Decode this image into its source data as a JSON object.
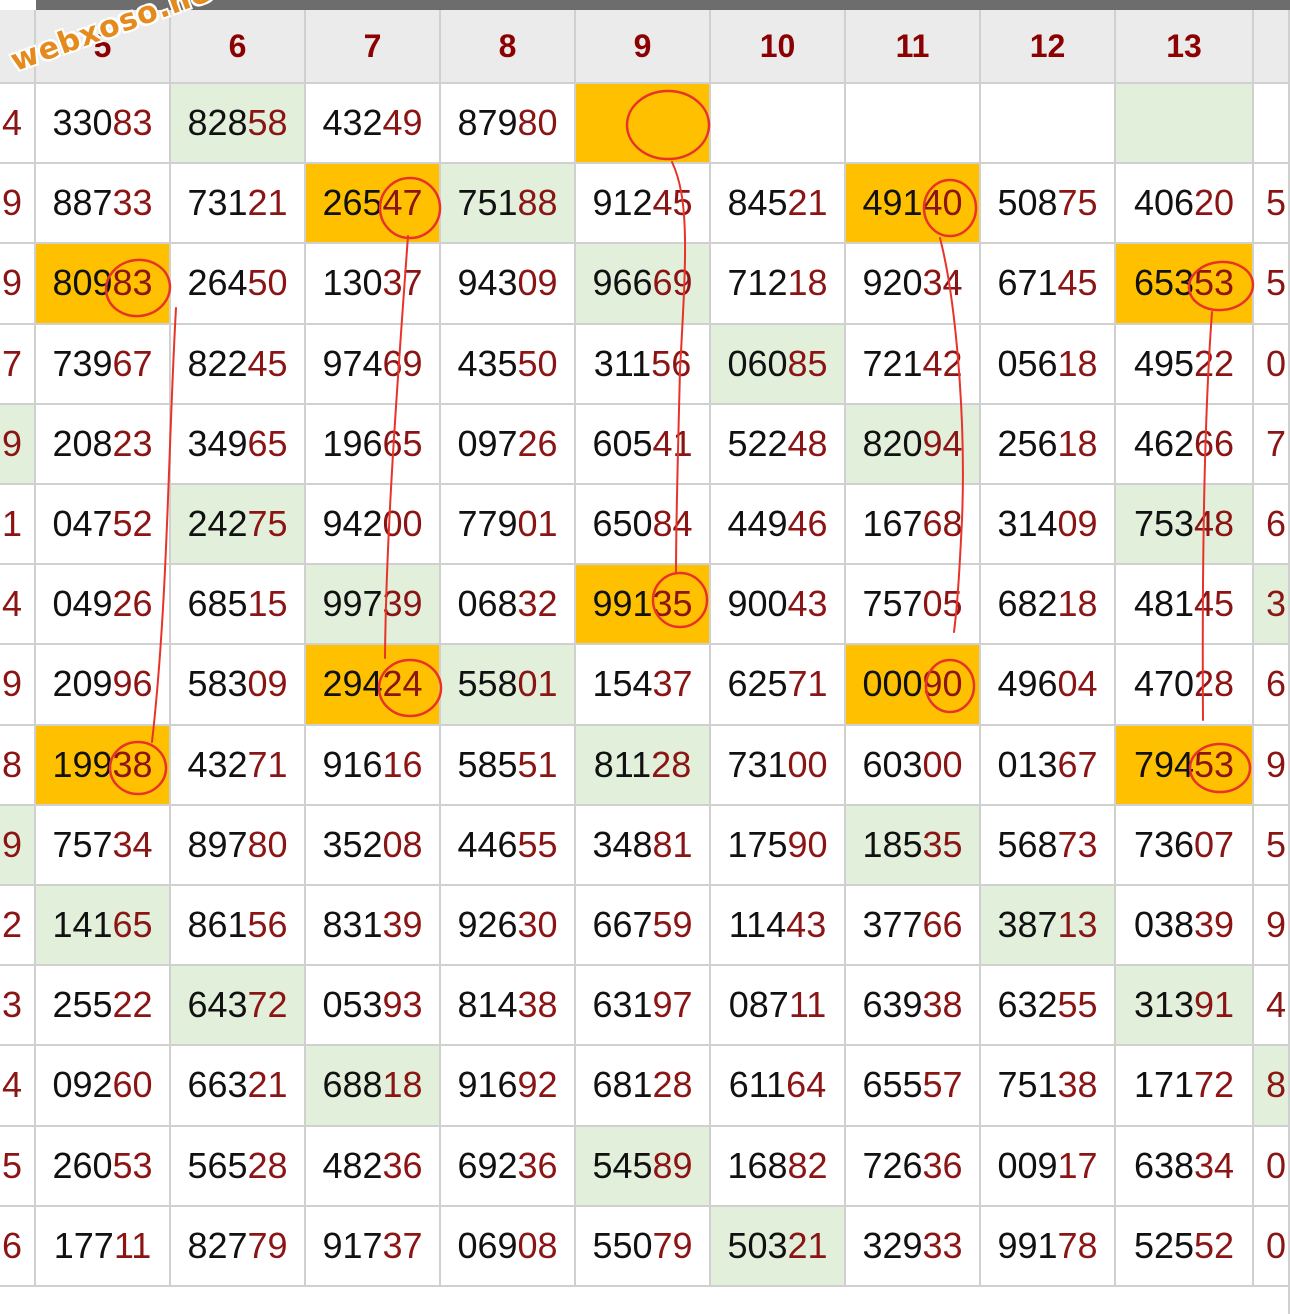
{
  "watermark": "webxoso.net",
  "headers": [
    "5",
    "6",
    "7",
    "8",
    "9",
    "10",
    "11",
    "12",
    "13"
  ],
  "rows": [
    {
      "left": "4",
      "cells": [
        "33083",
        "82858",
        "43249",
        "87980",
        "",
        "",
        "",
        "",
        ""
      ],
      "right": ""
    },
    {
      "left": "9",
      "cells": [
        "88733",
        "73121",
        "26547",
        "75188",
        "91245",
        "84521",
        "49140",
        "50875",
        "40620"
      ],
      "right": "5"
    },
    {
      "left": "9",
      "cells": [
        "80983",
        "26450",
        "13037",
        "94309",
        "96669",
        "71218",
        "92034",
        "67145",
        "65353"
      ],
      "right": "5"
    },
    {
      "left": "7",
      "cells": [
        "73967",
        "82245",
        "97469",
        "43550",
        "31156",
        "06085",
        "72142",
        "05618",
        "49522"
      ],
      "right": "0"
    },
    {
      "left": "9",
      "cells": [
        "20823",
        "34965",
        "19665",
        "09726",
        "60541",
        "52248",
        "82094",
        "25618",
        "46266"
      ],
      "right": "7"
    },
    {
      "left": "1",
      "cells": [
        "04752",
        "24275",
        "94200",
        "77901",
        "65084",
        "44946",
        "16768",
        "31409",
        "75348"
      ],
      "right": "6"
    },
    {
      "left": "4",
      "cells": [
        "04926",
        "68515",
        "99739",
        "06832",
        "99135",
        "90043",
        "75705",
        "68218",
        "48145"
      ],
      "right": "3"
    },
    {
      "left": "9",
      "cells": [
        "20996",
        "58309",
        "29424",
        "55801",
        "15437",
        "62571",
        "00090",
        "49604",
        "47028"
      ],
      "right": "6"
    },
    {
      "left": "8",
      "cells": [
        "19938",
        "43271",
        "91616",
        "58551",
        "81128",
        "73100",
        "60300",
        "01367",
        "79453"
      ],
      "right": "9"
    },
    {
      "left": "9",
      "cells": [
        "75734",
        "89780",
        "35208",
        "44655",
        "34881",
        "17590",
        "18535",
        "56873",
        "73607"
      ],
      "right": "5"
    },
    {
      "left": "2",
      "cells": [
        "14165",
        "86156",
        "83139",
        "92630",
        "66759",
        "11443",
        "37766",
        "38713",
        "03839"
      ],
      "right": "9"
    },
    {
      "left": "3",
      "cells": [
        "25522",
        "64372",
        "05393",
        "81438",
        "63197",
        "08711",
        "63938",
        "63255",
        "31391"
      ],
      "right": "4"
    },
    {
      "left": "4",
      "cells": [
        "09260",
        "66321",
        "68818",
        "91692",
        "68128",
        "61164",
        "65557",
        "75138",
        "17172"
      ],
      "right": "8"
    },
    {
      "left": "5",
      "cells": [
        "26053",
        "56528",
        "48236",
        "69236",
        "54589",
        "16882",
        "72636",
        "00917",
        "63834"
      ],
      "right": "0"
    },
    {
      "left": "6",
      "cells": [
        "17711",
        "82779",
        "91737",
        "06908",
        "55079",
        "50321",
        "32933",
        "99178",
        "52552"
      ],
      "right": "0"
    }
  ],
  "highlight": [
    [
      0,
      4
    ],
    [
      1,
      2
    ],
    [
      1,
      6
    ],
    [
      2,
      0
    ],
    [
      2,
      8
    ],
    [
      6,
      4
    ],
    [
      7,
      2
    ],
    [
      7,
      6
    ],
    [
      8,
      0
    ],
    [
      8,
      8
    ]
  ],
  "green": [
    [
      0,
      1
    ],
    [
      0,
      8
    ],
    [
      1,
      3
    ],
    [
      2,
      4
    ],
    [
      3,
      5
    ],
    [
      4,
      6
    ],
    [
      5,
      1
    ],
    [
      5,
      8
    ],
    [
      6,
      2
    ],
    [
      7,
      3
    ],
    [
      8,
      4
    ],
    [
      9,
      6
    ],
    [
      10,
      0
    ],
    [
      10,
      7
    ],
    [
      11,
      1
    ],
    [
      11,
      8
    ],
    [
      12,
      2
    ],
    [
      13,
      4
    ],
    [
      14,
      5
    ]
  ],
  "green_left": [
    4,
    9
  ],
  "green_right": [
    6,
    12
  ],
  "colors": {
    "header_bg": "#ebebeb",
    "header_text": "#8b0000",
    "highlight": "#ffc000",
    "green": "#e2efda",
    "suffix_text": "#8b1414",
    "pen": "#e8332b",
    "grid": "#d0d0d0"
  }
}
